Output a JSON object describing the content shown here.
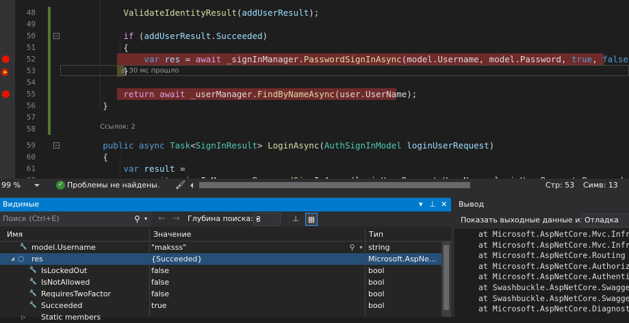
{
  "editor": {
    "hint": "≤ 30 мс прошло",
    "refs": "Ссылок: 2",
    "lines": [
      {
        "num": "48",
        "tokens": [
          {
            "t": "            "
          },
          {
            "t": "ValidateIdentityResult",
            "c": "me"
          },
          {
            "t": "("
          },
          {
            "t": "addUserResult",
            "c": "id"
          },
          {
            "t": ");"
          }
        ]
      },
      {
        "num": "49",
        "tokens": []
      },
      {
        "num": "50",
        "tokens": [
          {
            "t": "            "
          },
          {
            "t": "if",
            "c": "kwp"
          },
          {
            "t": " ("
          },
          {
            "t": "addUserResult",
            "c": "id"
          },
          {
            "t": "."
          },
          {
            "t": "Succeeded",
            "c": "id"
          },
          {
            "t": ")"
          }
        ]
      },
      {
        "num": "51",
        "tokens": [
          {
            "t": "            {"
          }
        ]
      },
      {
        "num": "52",
        "tokens": [
          {
            "t": "                "
          },
          {
            "t": "var",
            "c": "kw"
          },
          {
            "t": " "
          },
          {
            "t": "res",
            "c": "id"
          },
          {
            "t": " = "
          },
          {
            "t": "await",
            "c": "kwp"
          },
          {
            "t": " _signInManager."
          },
          {
            "t": "PasswordSignInAsync",
            "c": "me"
          },
          {
            "t": "(model.Username, model.Password, "
          },
          {
            "t": "true",
            "c": "kw"
          },
          {
            "t": ", "
          },
          {
            "t": "false",
            "c": "kw"
          },
          {
            "t": ");"
          }
        ]
      },
      {
        "num": "53",
        "tokens": [
          {
            "t": "            }"
          }
        ]
      },
      {
        "num": "54",
        "tokens": []
      },
      {
        "num": "55",
        "tokens": [
          {
            "t": "            "
          },
          {
            "t": "return",
            "c": "kwp"
          },
          {
            "t": " "
          },
          {
            "t": "await",
            "c": "kwp"
          },
          {
            "t": " _userManager."
          },
          {
            "t": "FindByNameAsync",
            "c": "me"
          },
          {
            "t": "(user.UserName);"
          }
        ]
      },
      {
        "num": "56",
        "tokens": [
          {
            "t": "        }"
          }
        ]
      },
      {
        "num": "57",
        "tokens": []
      },
      {
        "num": "58",
        "tokens": []
      },
      {
        "num": "59",
        "tokens": [
          {
            "t": "        "
          },
          {
            "t": "public",
            "c": "kw"
          },
          {
            "t": " "
          },
          {
            "t": "async",
            "c": "kw"
          },
          {
            "t": " "
          },
          {
            "t": "Task",
            "c": "ty"
          },
          {
            "t": "<"
          },
          {
            "t": "SignInResult",
            "c": "ty"
          },
          {
            "t": "> "
          },
          {
            "t": "LoginAsync",
            "c": "me"
          },
          {
            "t": "("
          },
          {
            "t": "AuthSignInModel",
            "c": "ty"
          },
          {
            "t": " "
          },
          {
            "t": "loginUserRequest",
            "c": "id"
          },
          {
            "t": ")"
          }
        ]
      },
      {
        "num": "60",
        "tokens": [
          {
            "t": "        {"
          }
        ]
      },
      {
        "num": "61",
        "tokens": [
          {
            "t": "            "
          },
          {
            "t": "var",
            "c": "kw"
          },
          {
            "t": " "
          },
          {
            "t": "result",
            "c": "id"
          },
          {
            "t": " ="
          }
        ]
      },
      {
        "num": "62",
        "tokens": [
          {
            "t": "                "
          },
          {
            "t": "await",
            "c": "kwp"
          },
          {
            "t": " _signInManager."
          },
          {
            "t": "PasswordSignInAsync",
            "c": "me"
          },
          {
            "t": "(loginUserRequest.UserName, loginUserRequest.Password, "
          },
          {
            "t": "true",
            "c": "kw"
          },
          {
            "t": ", "
          },
          {
            "t": "f",
            "c": "kw"
          }
        ]
      }
    ]
  },
  "status": {
    "zoom": "99 %",
    "issues": "Проблемы не найдены.",
    "line": "Стр: 53",
    "col": "Симв: 13"
  },
  "locals": {
    "title": "Видимые",
    "search_placeholder": "Поиск (Ctrl+E)",
    "depth_label": "Глубина поиска:",
    "depth_value": "3",
    "columns": {
      "name": "Имя",
      "value": "Значение",
      "type": "Тип"
    },
    "rows": [
      {
        "name": "model.Username",
        "value": "\"maksss\"",
        "type": "string"
      },
      {
        "name": "res",
        "value": "{Succeeded}",
        "type": "Microsoft.AspNe..."
      },
      {
        "name": "IsLockedOut",
        "value": "false",
        "type": "bool"
      },
      {
        "name": "IsNotAllowed",
        "value": "false",
        "type": "bool"
      },
      {
        "name": "RequiresTwoFactor",
        "value": "false",
        "type": "bool"
      },
      {
        "name": "Succeeded",
        "value": "true",
        "type": "bool"
      },
      {
        "name": "Static members",
        "value": "",
        "type": ""
      }
    ]
  },
  "output": {
    "title": "Вывод",
    "show_label": "Показать выходные данные из:",
    "source": "Отладка",
    "lines": [
      "at Microsoft.AspNetCore.Mvc.Infr",
      "at Microsoft.AspNetCore.Mvc.Infr",
      "at Microsoft.AspNetCore.Routing",
      "at Microsoft.AspNetCore.Authoriz",
      "at Microsoft.AspNetCore.Authenti",
      "at Swashbuckle.AspNetCore.Swagge",
      "at Swashbuckle.AspNetCore.Swagge",
      "at Microsoft.AspNetCore.Diagnost"
    ]
  },
  "colors": {
    "accent": "#007acc",
    "breakpoint": "#e51400",
    "breakpoint_line": "#6f2a2a",
    "selection": "#264f78"
  },
  "icons": [
    "breakpoint-icon",
    "current-line-arrow-icon",
    "check-icon",
    "brush-icon",
    "search-icon",
    "back-arrow-icon",
    "forward-arrow-icon",
    "pin-icon",
    "close-icon",
    "wrench-icon",
    "property-icon",
    "expand-icon"
  ]
}
